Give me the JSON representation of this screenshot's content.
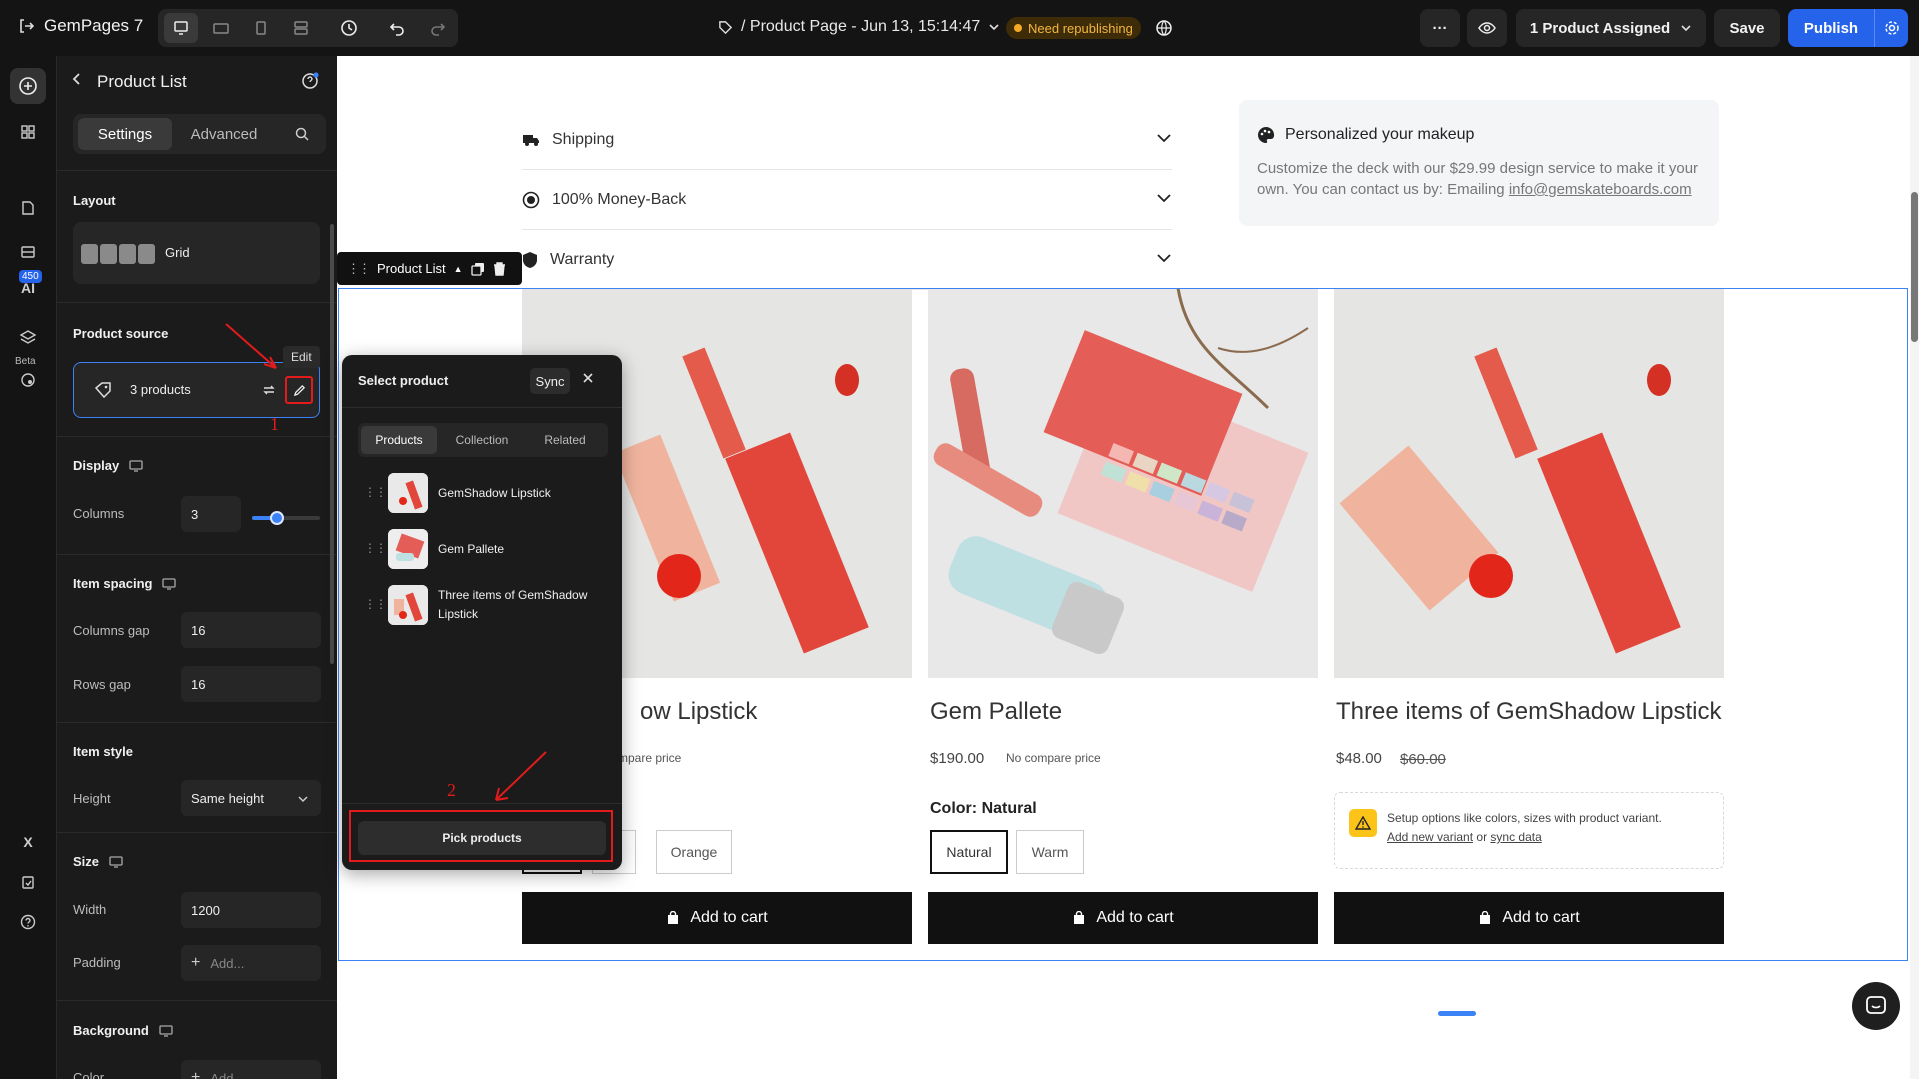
{
  "topbar": {
    "logo": "GemPages 7",
    "page_title": "/ Product Page - Jun 13, 15:14:47",
    "badge": "Need republishing",
    "assigned": "1 Product Assigned",
    "save": "Save",
    "publish": "Publish"
  },
  "rail": {
    "count": "450",
    "beta": "Beta"
  },
  "panel": {
    "title": "Product List",
    "tabs": [
      "Settings",
      "Advanced"
    ],
    "layout_label": "Layout",
    "layout_value": "Grid",
    "source_label": "Product source",
    "source_value": "3 products",
    "edit_tip": "Edit",
    "display_label": "Display",
    "columns_label": "Columns",
    "columns_value": "3",
    "columns_slider_fraction": 0.37,
    "spacing_label": "Item spacing",
    "col_gap_label": "Columns gap",
    "col_gap_value": "16",
    "row_gap_label": "Rows gap",
    "row_gap_value": "16",
    "style_label": "Item style",
    "height_label": "Height",
    "height_value": "Same height",
    "size_label": "Size",
    "width_label": "Width",
    "width_value": "1200",
    "padding_label": "Padding",
    "padding_placeholder": "Add...",
    "bg_label": "Background",
    "color_label": "Color",
    "color_placeholder": "Add..."
  },
  "canvas": {
    "accordion": [
      "Shipping",
      "100% Money-Back",
      "Warranty"
    ],
    "makeup_title": "Personalized your makeup",
    "makeup_text": "Customize the deck with our $29.99 design service to make it your own. You can contact us by: Emailing ",
    "makeup_email": "info@gemskateboards.com",
    "selection_tag": "Product List",
    "products": [
      {
        "name": "GemShadow Lipstick",
        "visible_name": "ow Lipstick",
        "compare": "mpare price",
        "options_visible": [
          "d",
          "Orange"
        ],
        "cart": "Add to cart"
      },
      {
        "name": "Gem Pallete",
        "price": "$190.00",
        "compare": "No compare price",
        "color_label": "Color:",
        "color_value": "Natural",
        "options": [
          "Natural",
          "Warm"
        ],
        "cart": "Add to cart"
      },
      {
        "name": "Three items of GemShadow Lipstick",
        "price": "$48.00",
        "compare": "$60.00",
        "notice": "Setup options like colors, sizes with product variant.",
        "notice_link1": "Add new variant",
        "notice_or": "or",
        "notice_link2": "sync data",
        "cart": "Add to cart"
      }
    ]
  },
  "popup": {
    "title": "Select product",
    "sync": "Sync",
    "tabs": [
      "Products",
      "Collection",
      "Related"
    ],
    "items": [
      "GemShadow Lipstick",
      "Gem Pallete",
      "Three items of GemShadow Lipstick"
    ],
    "pick": "Pick products"
  },
  "annotations": {
    "label1": "1",
    "label2": "2"
  },
  "colors": {
    "accent": "#2563eb",
    "annotation": "#e31b1b",
    "badge": "#f4a825"
  }
}
